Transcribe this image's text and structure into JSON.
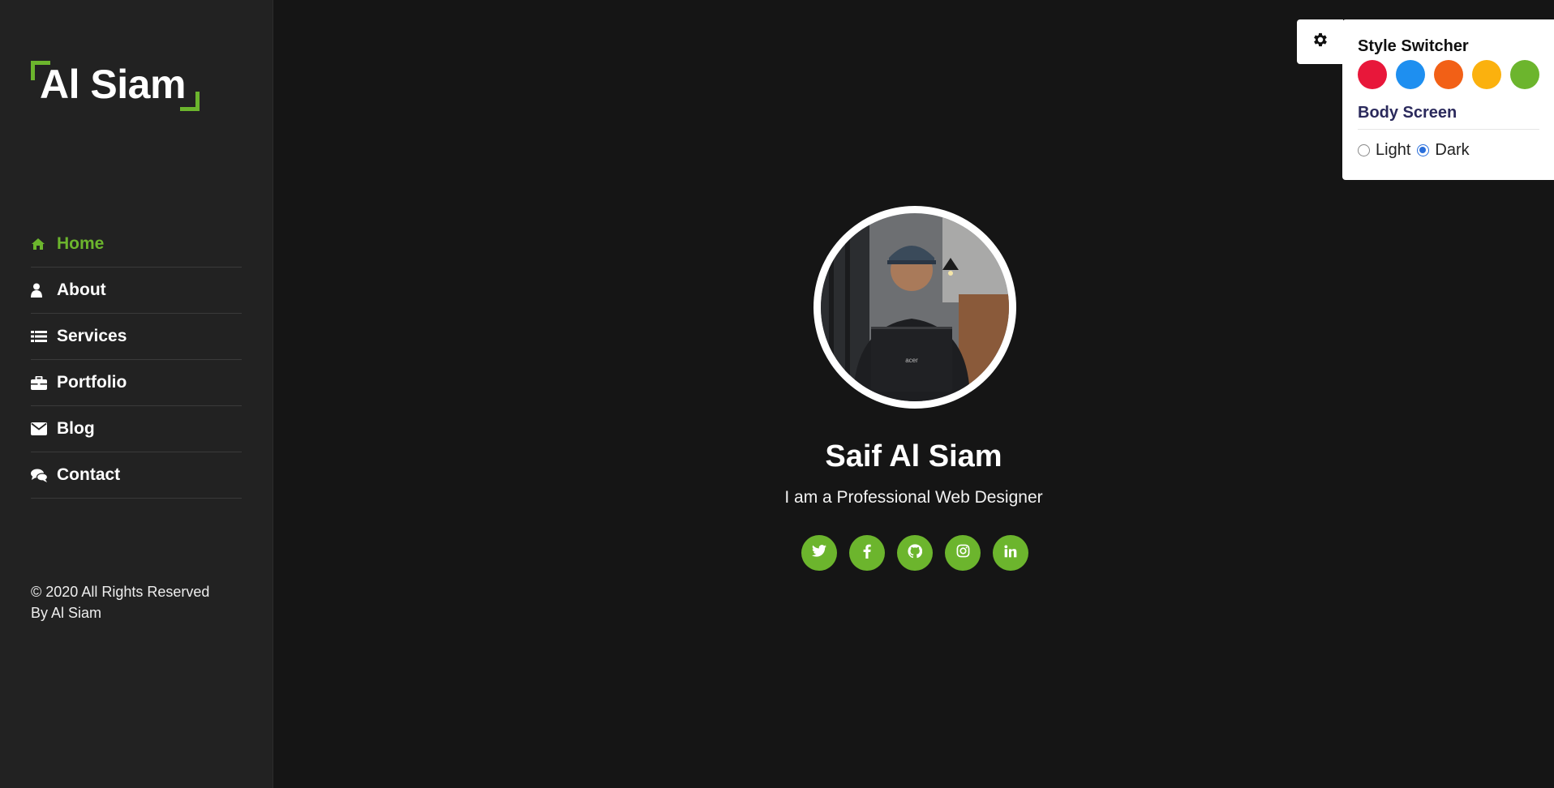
{
  "brand": {
    "logo_text": "Al Siam",
    "accent_color": "#6cb52d"
  },
  "sidebar": {
    "items": [
      {
        "label": "Home",
        "icon": "home-icon",
        "active": true
      },
      {
        "label": "About",
        "icon": "user-icon",
        "active": false
      },
      {
        "label": "Services",
        "icon": "list-icon",
        "active": false
      },
      {
        "label": "Portfolio",
        "icon": "briefcase-icon",
        "active": false
      },
      {
        "label": "Blog",
        "icon": "envelope-icon",
        "active": false
      },
      {
        "label": "Contact",
        "icon": "chat-icon",
        "active": false
      }
    ],
    "copyright_line1": "© 2020 All Rights Reserved",
    "copyright_line2": "By Al Siam"
  },
  "hero": {
    "name": "Saif Al Siam",
    "tagline": "I am a Professional Web Designer",
    "socials": [
      "twitter-icon",
      "facebook-icon",
      "github-icon",
      "instagram-icon",
      "linkedin-icon"
    ]
  },
  "switcher": {
    "title": "Style Switcher",
    "colors": [
      "#e8173a",
      "#1e8ff0",
      "#f26016",
      "#fbb10e",
      "#6cb52d"
    ],
    "body_screen_label": "Body Screen",
    "modes": [
      {
        "label": "Light",
        "checked": false
      },
      {
        "label": "Dark",
        "checked": true
      }
    ]
  }
}
